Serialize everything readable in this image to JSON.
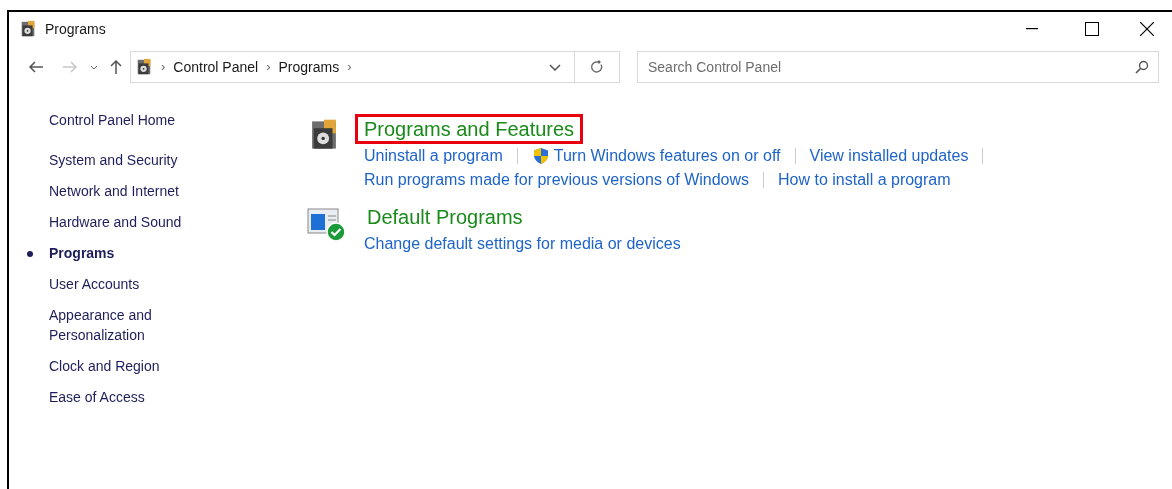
{
  "window": {
    "title": "Programs"
  },
  "navigation": {
    "back_disabled": false,
    "forward_disabled": true
  },
  "breadcrumb": {
    "separator": "›",
    "items": [
      "Control Panel",
      "Programs"
    ]
  },
  "search": {
    "placeholder": "Search Control Panel"
  },
  "sidebar": {
    "home": "Control Panel Home",
    "items": [
      {
        "label": "System and Security",
        "selected": false
      },
      {
        "label": "Network and Internet",
        "selected": false
      },
      {
        "label": "Hardware and Sound",
        "selected": false
      },
      {
        "label": "Programs",
        "selected": true
      },
      {
        "label": "User Accounts",
        "selected": false
      },
      {
        "label": "Appearance and Personalization",
        "selected": false
      },
      {
        "label": "Clock and Region",
        "selected": false
      },
      {
        "label": "Ease of Access",
        "selected": false
      }
    ]
  },
  "sections": [
    {
      "kind": "programs",
      "title": "Programs and Features",
      "highlighted": true,
      "link_rows": [
        [
          {
            "label": "Uninstall a program",
            "shield": false
          },
          {
            "label": "Turn Windows features on or off",
            "shield": true
          },
          {
            "label": "View installed updates",
            "shield": false
          }
        ],
        [
          {
            "label": "Run programs made for previous versions of Windows",
            "shield": false
          },
          {
            "label": "How to install a program",
            "shield": false
          }
        ]
      ]
    },
    {
      "kind": "defaults",
      "title": "Default Programs",
      "highlighted": false,
      "link_rows": [
        [
          {
            "label": "Change default settings for media or devices",
            "shield": false
          }
        ]
      ]
    }
  ]
}
